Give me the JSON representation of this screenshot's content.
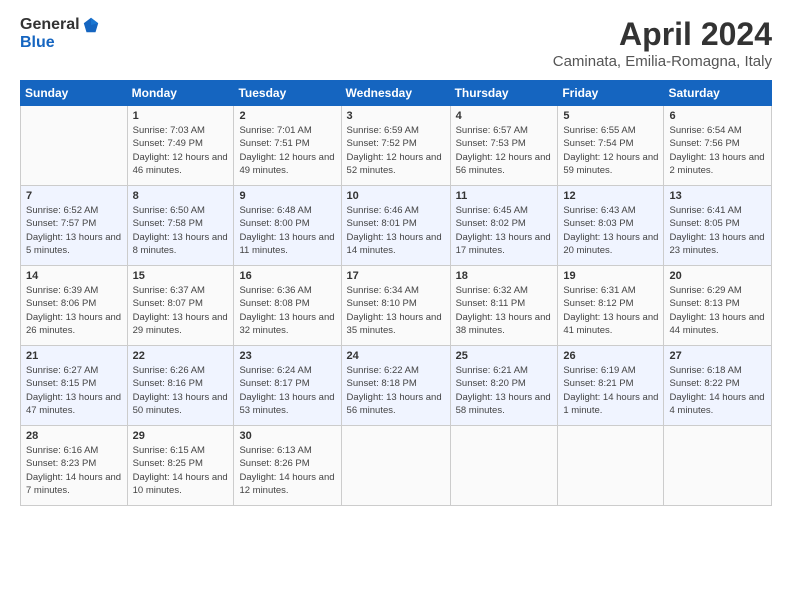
{
  "logo": {
    "general": "General",
    "blue": "Blue"
  },
  "title": "April 2024",
  "subtitle": "Caminata, Emilia-Romagna, Italy",
  "headers": [
    "Sunday",
    "Monday",
    "Tuesday",
    "Wednesday",
    "Thursday",
    "Friday",
    "Saturday"
  ],
  "weeks": [
    [
      {
        "day": "",
        "sunrise": "",
        "sunset": "",
        "daylight": ""
      },
      {
        "day": "1",
        "sunrise": "Sunrise: 7:03 AM",
        "sunset": "Sunset: 7:49 PM",
        "daylight": "Daylight: 12 hours and 46 minutes."
      },
      {
        "day": "2",
        "sunrise": "Sunrise: 7:01 AM",
        "sunset": "Sunset: 7:51 PM",
        "daylight": "Daylight: 12 hours and 49 minutes."
      },
      {
        "day": "3",
        "sunrise": "Sunrise: 6:59 AM",
        "sunset": "Sunset: 7:52 PM",
        "daylight": "Daylight: 12 hours and 52 minutes."
      },
      {
        "day": "4",
        "sunrise": "Sunrise: 6:57 AM",
        "sunset": "Sunset: 7:53 PM",
        "daylight": "Daylight: 12 hours and 56 minutes."
      },
      {
        "day": "5",
        "sunrise": "Sunrise: 6:55 AM",
        "sunset": "Sunset: 7:54 PM",
        "daylight": "Daylight: 12 hours and 59 minutes."
      },
      {
        "day": "6",
        "sunrise": "Sunrise: 6:54 AM",
        "sunset": "Sunset: 7:56 PM",
        "daylight": "Daylight: 13 hours and 2 minutes."
      }
    ],
    [
      {
        "day": "7",
        "sunrise": "Sunrise: 6:52 AM",
        "sunset": "Sunset: 7:57 PM",
        "daylight": "Daylight: 13 hours and 5 minutes."
      },
      {
        "day": "8",
        "sunrise": "Sunrise: 6:50 AM",
        "sunset": "Sunset: 7:58 PM",
        "daylight": "Daylight: 13 hours and 8 minutes."
      },
      {
        "day": "9",
        "sunrise": "Sunrise: 6:48 AM",
        "sunset": "Sunset: 8:00 PM",
        "daylight": "Daylight: 13 hours and 11 minutes."
      },
      {
        "day": "10",
        "sunrise": "Sunrise: 6:46 AM",
        "sunset": "Sunset: 8:01 PM",
        "daylight": "Daylight: 13 hours and 14 minutes."
      },
      {
        "day": "11",
        "sunrise": "Sunrise: 6:45 AM",
        "sunset": "Sunset: 8:02 PM",
        "daylight": "Daylight: 13 hours and 17 minutes."
      },
      {
        "day": "12",
        "sunrise": "Sunrise: 6:43 AM",
        "sunset": "Sunset: 8:03 PM",
        "daylight": "Daylight: 13 hours and 20 minutes."
      },
      {
        "day": "13",
        "sunrise": "Sunrise: 6:41 AM",
        "sunset": "Sunset: 8:05 PM",
        "daylight": "Daylight: 13 hours and 23 minutes."
      }
    ],
    [
      {
        "day": "14",
        "sunrise": "Sunrise: 6:39 AM",
        "sunset": "Sunset: 8:06 PM",
        "daylight": "Daylight: 13 hours and 26 minutes."
      },
      {
        "day": "15",
        "sunrise": "Sunrise: 6:37 AM",
        "sunset": "Sunset: 8:07 PM",
        "daylight": "Daylight: 13 hours and 29 minutes."
      },
      {
        "day": "16",
        "sunrise": "Sunrise: 6:36 AM",
        "sunset": "Sunset: 8:08 PM",
        "daylight": "Daylight: 13 hours and 32 minutes."
      },
      {
        "day": "17",
        "sunrise": "Sunrise: 6:34 AM",
        "sunset": "Sunset: 8:10 PM",
        "daylight": "Daylight: 13 hours and 35 minutes."
      },
      {
        "day": "18",
        "sunrise": "Sunrise: 6:32 AM",
        "sunset": "Sunset: 8:11 PM",
        "daylight": "Daylight: 13 hours and 38 minutes."
      },
      {
        "day": "19",
        "sunrise": "Sunrise: 6:31 AM",
        "sunset": "Sunset: 8:12 PM",
        "daylight": "Daylight: 13 hours and 41 minutes."
      },
      {
        "day": "20",
        "sunrise": "Sunrise: 6:29 AM",
        "sunset": "Sunset: 8:13 PM",
        "daylight": "Daylight: 13 hours and 44 minutes."
      }
    ],
    [
      {
        "day": "21",
        "sunrise": "Sunrise: 6:27 AM",
        "sunset": "Sunset: 8:15 PM",
        "daylight": "Daylight: 13 hours and 47 minutes."
      },
      {
        "day": "22",
        "sunrise": "Sunrise: 6:26 AM",
        "sunset": "Sunset: 8:16 PM",
        "daylight": "Daylight: 13 hours and 50 minutes."
      },
      {
        "day": "23",
        "sunrise": "Sunrise: 6:24 AM",
        "sunset": "Sunset: 8:17 PM",
        "daylight": "Daylight: 13 hours and 53 minutes."
      },
      {
        "day": "24",
        "sunrise": "Sunrise: 6:22 AM",
        "sunset": "Sunset: 8:18 PM",
        "daylight": "Daylight: 13 hours and 56 minutes."
      },
      {
        "day": "25",
        "sunrise": "Sunrise: 6:21 AM",
        "sunset": "Sunset: 8:20 PM",
        "daylight": "Daylight: 13 hours and 58 minutes."
      },
      {
        "day": "26",
        "sunrise": "Sunrise: 6:19 AM",
        "sunset": "Sunset: 8:21 PM",
        "daylight": "Daylight: 14 hours and 1 minute."
      },
      {
        "day": "27",
        "sunrise": "Sunrise: 6:18 AM",
        "sunset": "Sunset: 8:22 PM",
        "daylight": "Daylight: 14 hours and 4 minutes."
      }
    ],
    [
      {
        "day": "28",
        "sunrise": "Sunrise: 6:16 AM",
        "sunset": "Sunset: 8:23 PM",
        "daylight": "Daylight: 14 hours and 7 minutes."
      },
      {
        "day": "29",
        "sunrise": "Sunrise: 6:15 AM",
        "sunset": "Sunset: 8:25 PM",
        "daylight": "Daylight: 14 hours and 10 minutes."
      },
      {
        "day": "30",
        "sunrise": "Sunrise: 6:13 AM",
        "sunset": "Sunset: 8:26 PM",
        "daylight": "Daylight: 14 hours and 12 minutes."
      },
      {
        "day": "",
        "sunrise": "",
        "sunset": "",
        "daylight": ""
      },
      {
        "day": "",
        "sunrise": "",
        "sunset": "",
        "daylight": ""
      },
      {
        "day": "",
        "sunrise": "",
        "sunset": "",
        "daylight": ""
      },
      {
        "day": "",
        "sunrise": "",
        "sunset": "",
        "daylight": ""
      }
    ]
  ]
}
